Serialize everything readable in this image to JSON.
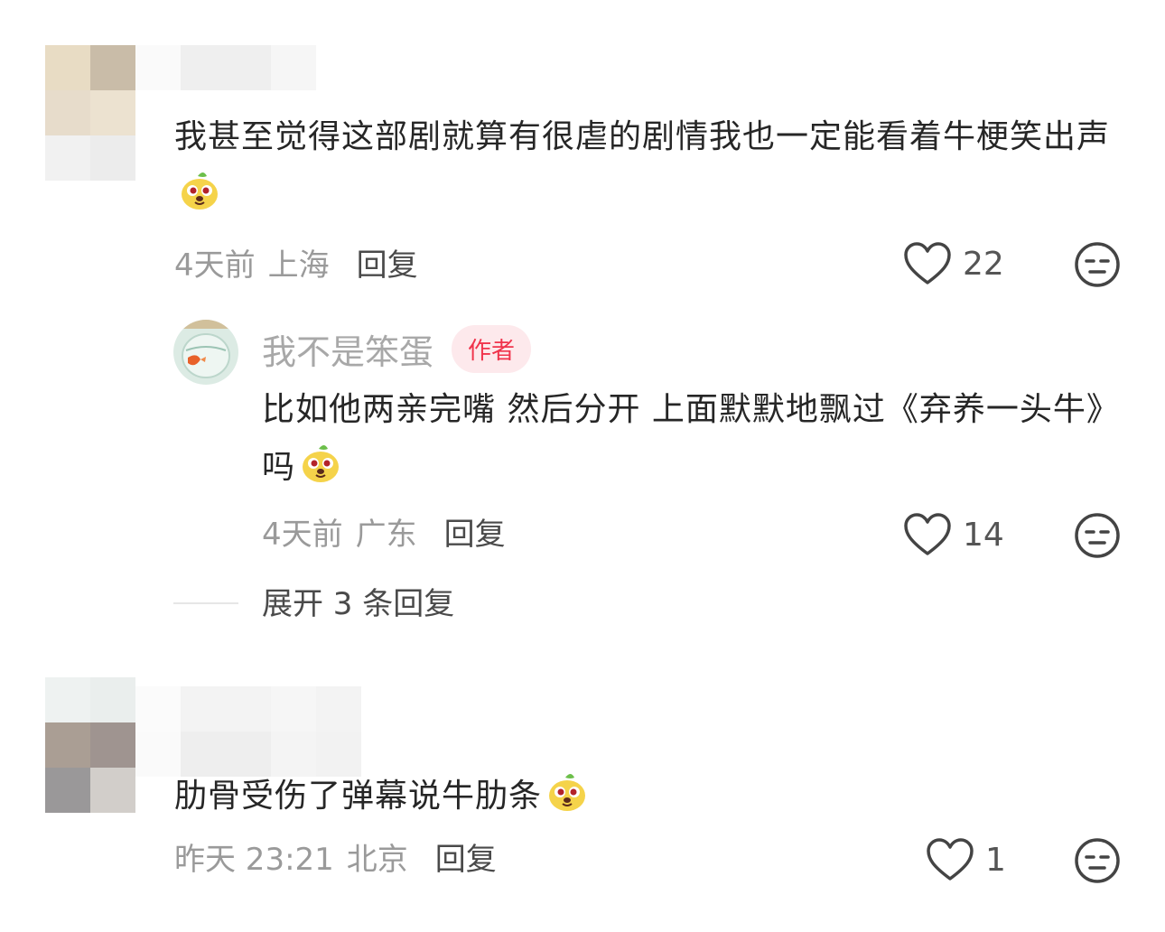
{
  "comments": [
    {
      "text": "我甚至觉得这部剧就算有很虐的剧情我也一定能看着牛梗笑出声",
      "time": "4天前",
      "location": "上海",
      "reply_label": "回复",
      "likes": "22",
      "emoji": "dog-emoji"
    },
    {
      "text": "肋骨受伤了弹幕说牛肋条",
      "time": "昨天 23:21",
      "location": "北京",
      "reply_label": "回复",
      "likes": "1",
      "emoji": "dog-emoji"
    }
  ],
  "reply": {
    "username": "我不是笨蛋",
    "badge": "作者",
    "text": "比如他两亲完嘴 然后分开 上面默默地飘过《弃养一头牛》吗",
    "time": "4天前",
    "location": "广东",
    "reply_label": "回复",
    "likes": "14"
  },
  "expand": {
    "label": "展开 3 条回复"
  },
  "colors": {
    "badge_bg": "#fde9ec",
    "badge_text": "#f0344c"
  }
}
